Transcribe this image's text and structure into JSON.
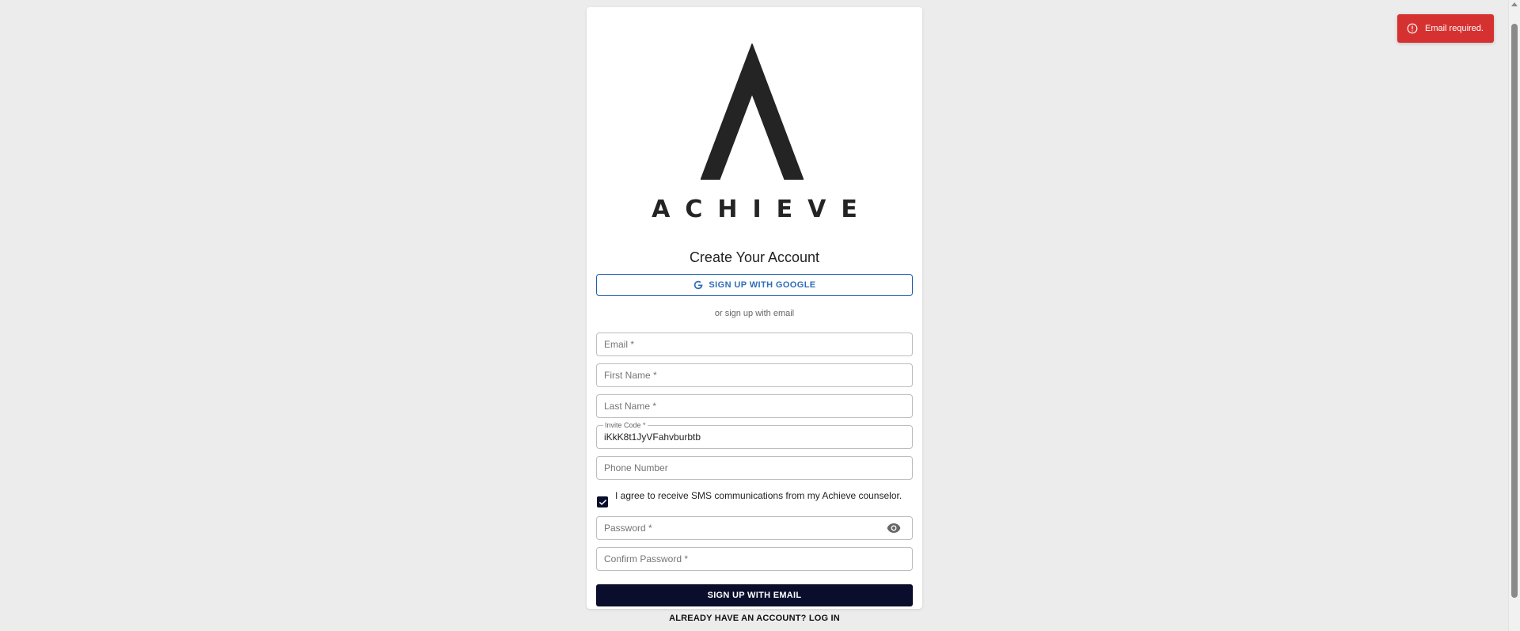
{
  "brand": {
    "name": "ACHIEVE",
    "logo_icon": "achieve-a-mark",
    "logo_color": "#242424"
  },
  "form": {
    "title": "Create Your Account",
    "google_button": "SIGN UP WITH GOOGLE",
    "divider_text": "or sign up with email",
    "email": {
      "placeholder": "Email *",
      "value": ""
    },
    "first_name": {
      "placeholder": "First Name *",
      "value": ""
    },
    "last_name": {
      "placeholder": "Last Name *",
      "value": ""
    },
    "invite_code": {
      "label": "Invite Code *",
      "value": "iKkK8t1JyVFahvburbtb"
    },
    "phone": {
      "placeholder": "Phone Number",
      "value": ""
    },
    "sms_consent": {
      "checked": true,
      "label": "I agree to receive SMS communications from my Achieve counselor."
    },
    "password": {
      "placeholder": "Password *",
      "value": "",
      "toggle_icon": "eye-icon"
    },
    "confirm_password": {
      "placeholder": "Confirm Password *",
      "value": ""
    },
    "submit_button": "SIGN UP WITH EMAIL",
    "login_link": "ALREADY HAVE AN ACCOUNT? LOG IN"
  },
  "toast": {
    "message": "Email required.",
    "icon": "alert-circle-icon",
    "color": "#d63131"
  },
  "colors": {
    "primary_dark": "#0a0e2c",
    "google_blue": "#2f6db8",
    "background": "#ececec"
  }
}
